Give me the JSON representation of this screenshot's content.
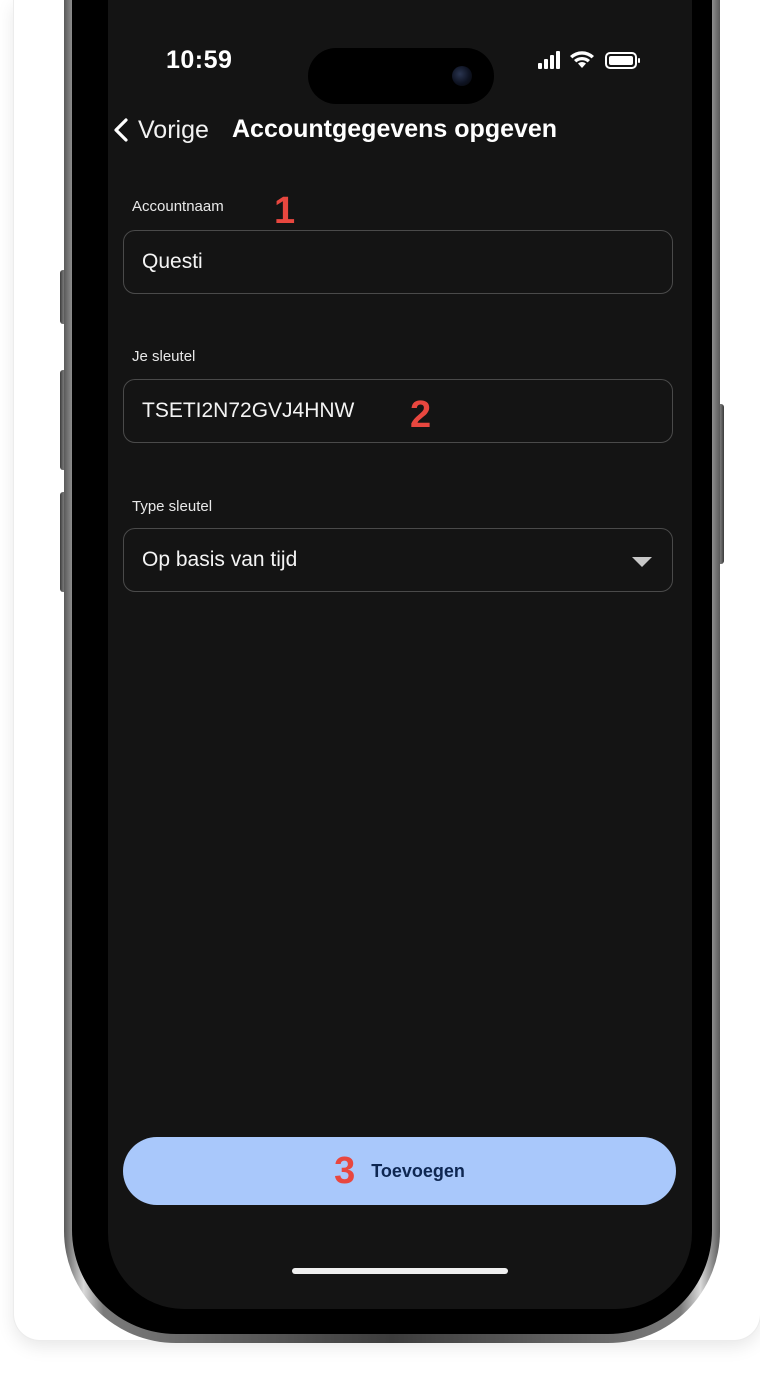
{
  "status_bar": {
    "time": "10:59",
    "icons": [
      "cellular-signal-icon",
      "wifi-icon",
      "battery-icon"
    ]
  },
  "nav": {
    "back_label": "Vorige",
    "title": "Accountgegevens opgeven"
  },
  "form": {
    "account_name": {
      "label": "Accountnaam",
      "value": "Questi",
      "marker": "1"
    },
    "key": {
      "label": "Je sleutel",
      "value": "TSETI2N72GVJ4HNW",
      "marker": "2"
    },
    "key_type": {
      "label": "Type sleutel",
      "selected": "Op basis van tijd"
    }
  },
  "actions": {
    "add_label": "Toevoegen",
    "add_marker": "3"
  },
  "colors": {
    "screen_background": "#141414",
    "primary_button": "#a9c8fb",
    "primary_button_text": "#0e2752",
    "annotation_marker": "#e8473f"
  }
}
